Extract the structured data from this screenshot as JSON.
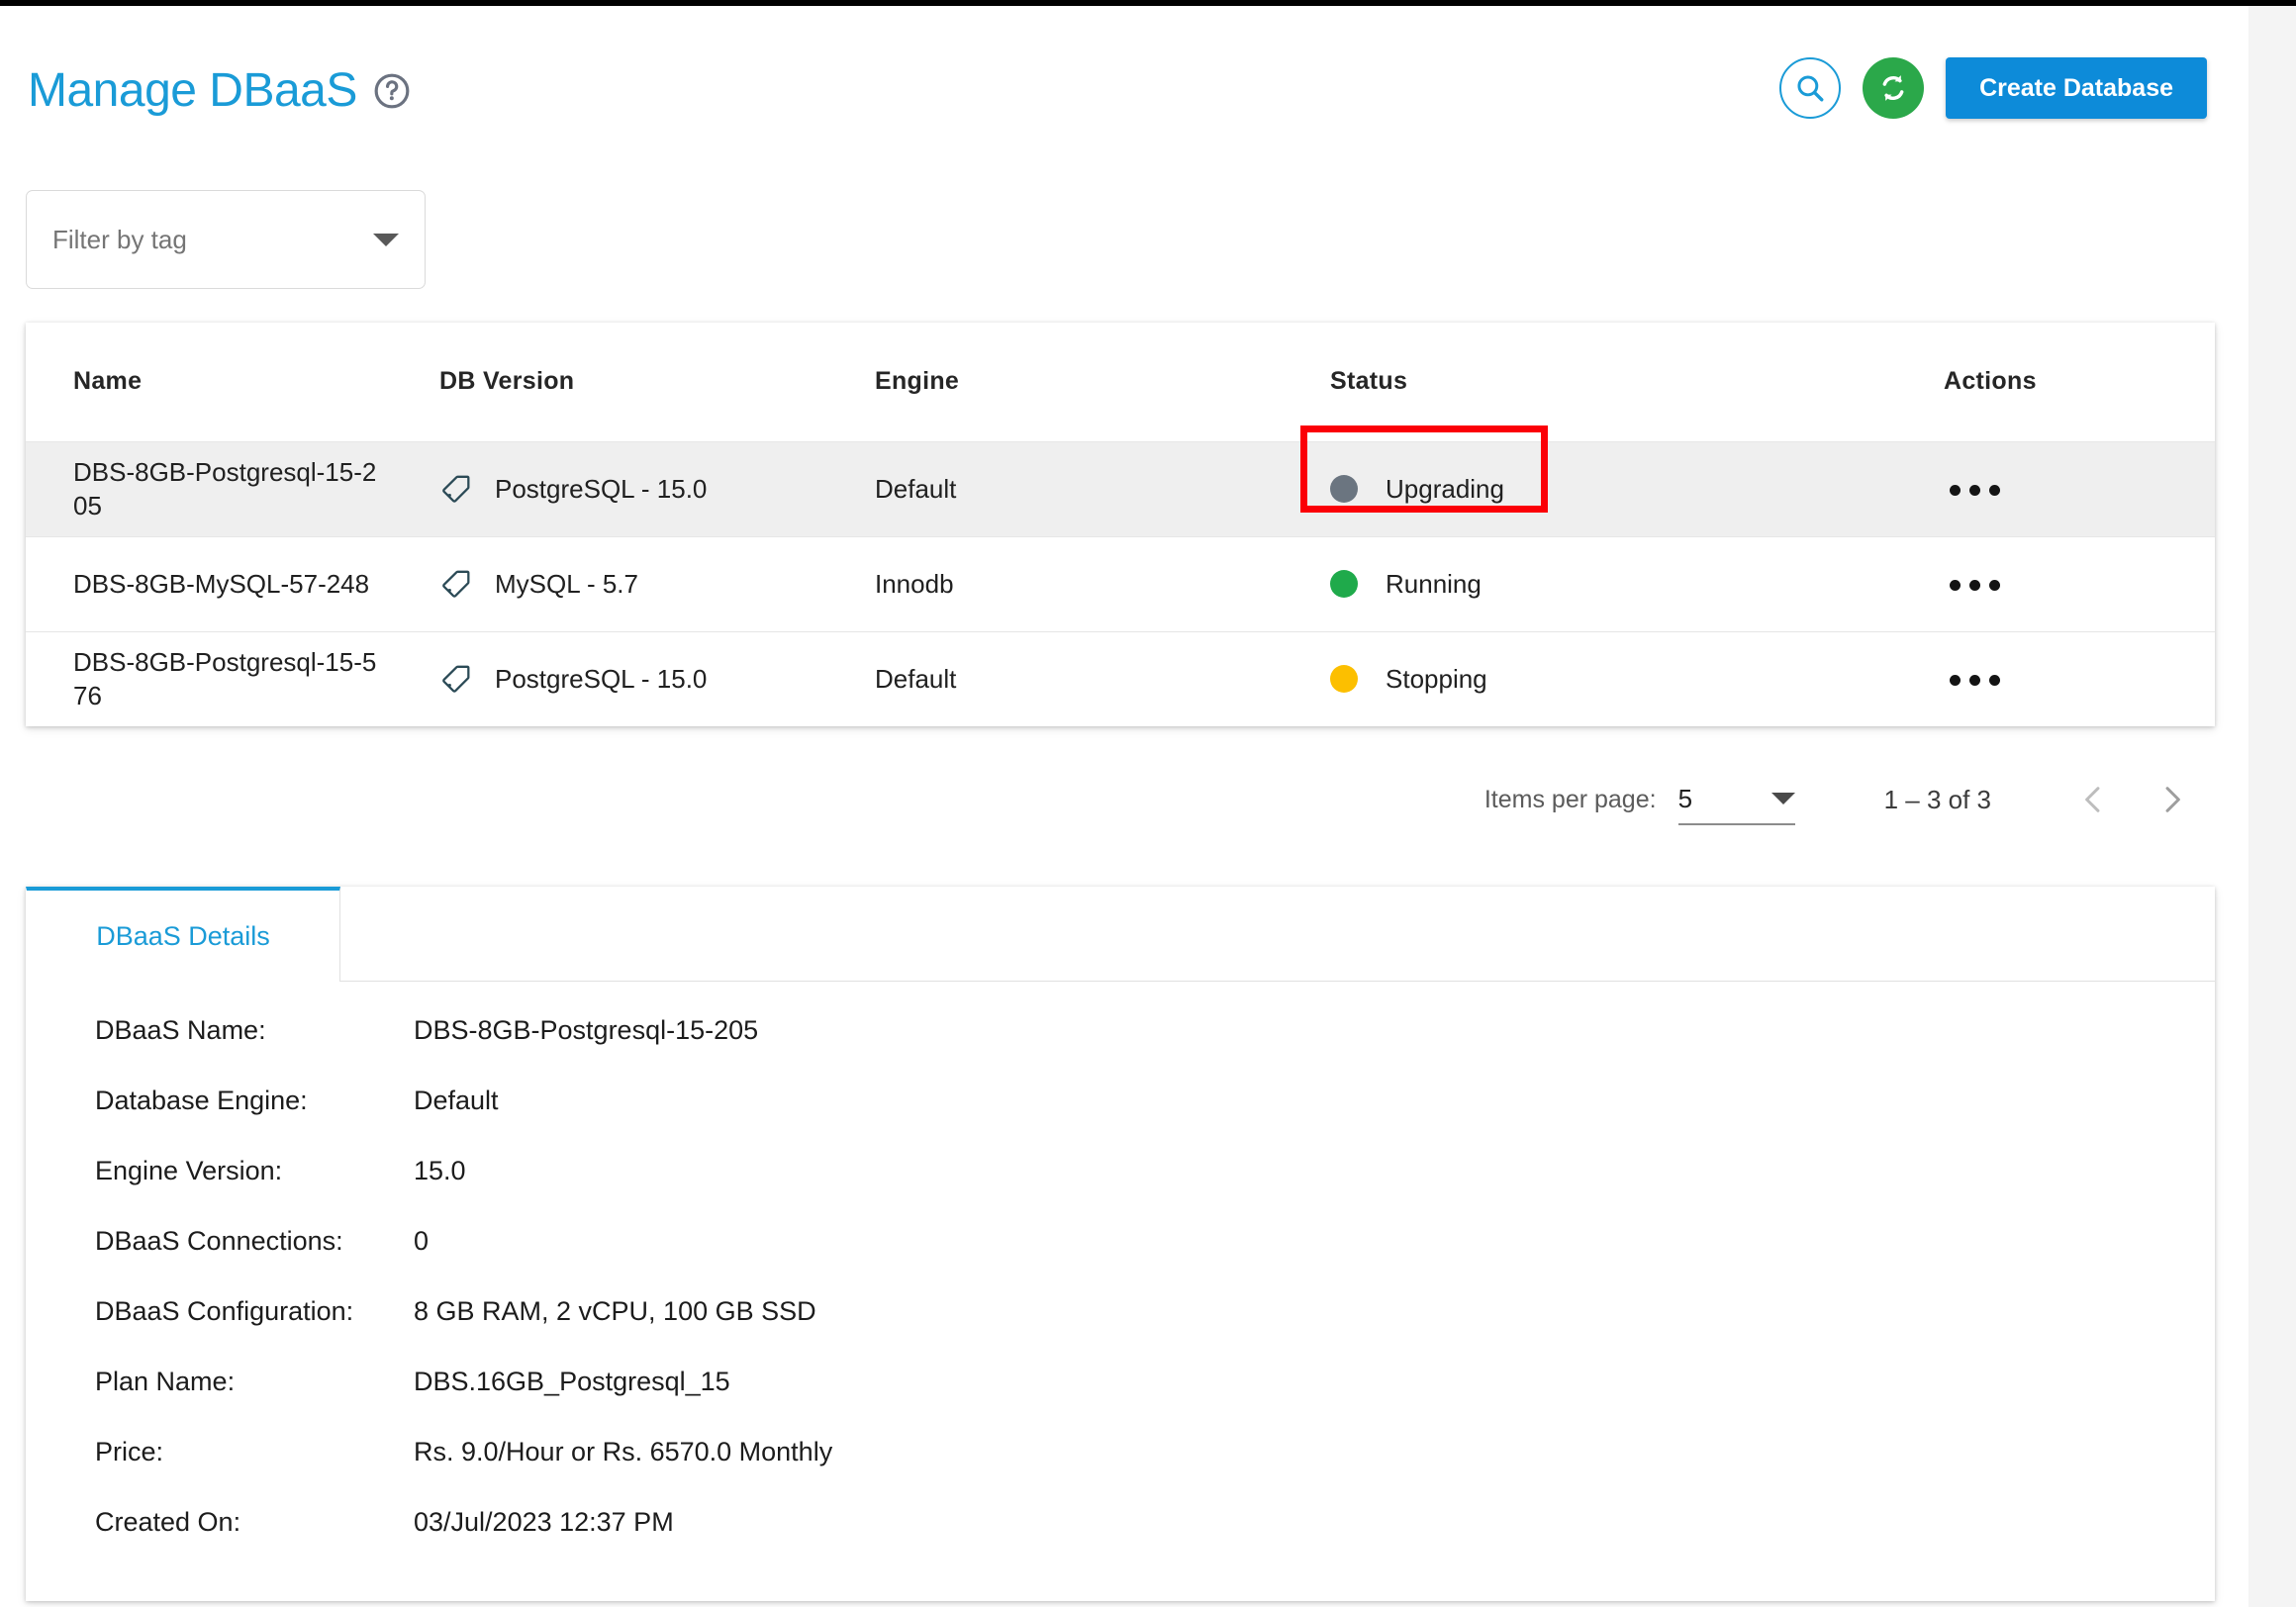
{
  "header": {
    "title": "Manage DBaaS",
    "help_icon": "help-circle-icon",
    "search_icon": "search-icon",
    "refresh_icon": "refresh-icon",
    "create_button": "Create Database"
  },
  "filter": {
    "placeholder": "Filter by tag",
    "value": "",
    "caret_icon": "chevron-down-icon"
  },
  "table": {
    "columns": [
      "Name",
      "DB Version",
      "Engine",
      "Status",
      "Actions"
    ],
    "rows": [
      {
        "name": "DBS-8GB-Postgresql-15-205",
        "version": "PostgreSQL - 15.0",
        "version_icon": "tag-icon",
        "engine": "Default",
        "status": "Upgrading",
        "status_color": "#6b7580",
        "actions_icon": "more-options-icon",
        "selected": true,
        "highlighted": true
      },
      {
        "name": "DBS-8GB-MySQL-57-248",
        "version": "MySQL - 5.7",
        "version_icon": "tag-icon",
        "engine": "Innodb",
        "status": "Running",
        "status_color": "#1faa4b",
        "actions_icon": "more-options-icon",
        "selected": false,
        "highlighted": false
      },
      {
        "name": "DBS-8GB-Postgresql-15-576",
        "version": "PostgreSQL - 15.0",
        "version_icon": "tag-icon",
        "engine": "Default",
        "status": "Stopping",
        "status_color": "#fcbf00",
        "actions_icon": "more-options-icon",
        "selected": false,
        "highlighted": false
      }
    ]
  },
  "paginator": {
    "items_per_page_label": "Items per page:",
    "items_per_page_value": "5",
    "range_label": "1 – 3 of 3",
    "prev_icon": "chevron-left-icon",
    "next_icon": "chevron-right-icon"
  },
  "details": {
    "tabs": [
      {
        "label": "DBaaS Details",
        "active": true
      }
    ],
    "fields": [
      {
        "label": "DBaaS Name:",
        "value": "DBS-8GB-Postgresql-15-205"
      },
      {
        "label": "Database Engine:",
        "value": "Default"
      },
      {
        "label": "Engine Version:",
        "value": "15.0"
      },
      {
        "label": "DBaaS Connections:",
        "value": "0"
      },
      {
        "label": "DBaaS Configuration:",
        "value": "8 GB RAM, 2 vCPU, 100 GB SSD"
      },
      {
        "label": "Plan Name:",
        "value": "DBS.16GB_Postgresql_15"
      },
      {
        "label": "Price:",
        "value": "Rs. 9.0/Hour or Rs. 6570.0 Monthly"
      },
      {
        "label": "Created On:",
        "value": "03/Jul/2023 12:37 PM"
      }
    ]
  },
  "colors": {
    "brand_blue": "#1a9bd7",
    "button_blue": "#0d8bd9",
    "refresh_green": "#2ba84a",
    "annotation_red": "#fb0007",
    "status_upgrading": "#6b7580",
    "status_running": "#1faa4b",
    "status_stopping": "#fcbf00"
  }
}
